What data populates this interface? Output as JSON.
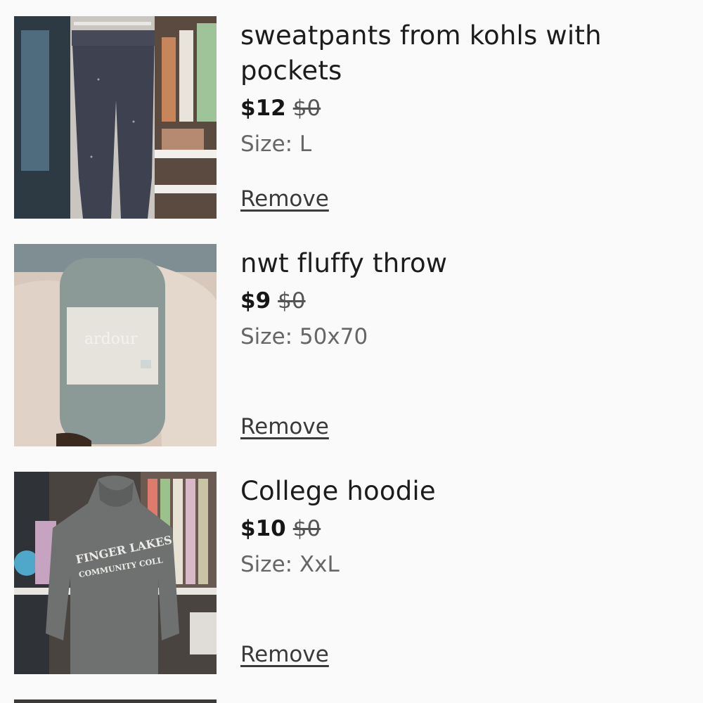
{
  "cart": {
    "items": [
      {
        "title": "sweatpants from kohls with pockets",
        "price": "$12",
        "original_price": "$0",
        "size": "Size: L",
        "remove_label": "Remove",
        "image_icon": "sweatpants-photo"
      },
      {
        "title": "nwt fluffy throw",
        "price": "$9",
        "original_price": "$0",
        "size": "Size: 50x70",
        "remove_label": "Remove",
        "image_icon": "throw-blanket-photo",
        "image_text": "ardour"
      },
      {
        "title": "College hoodie",
        "price": "$10",
        "original_price": "$0",
        "size": "Size: XxL",
        "remove_label": "Remove",
        "image_icon": "hoodie-photo",
        "image_text_line1": "FINGER LAKES",
        "image_text_line2": "COMMUNITY COLL"
      }
    ]
  }
}
